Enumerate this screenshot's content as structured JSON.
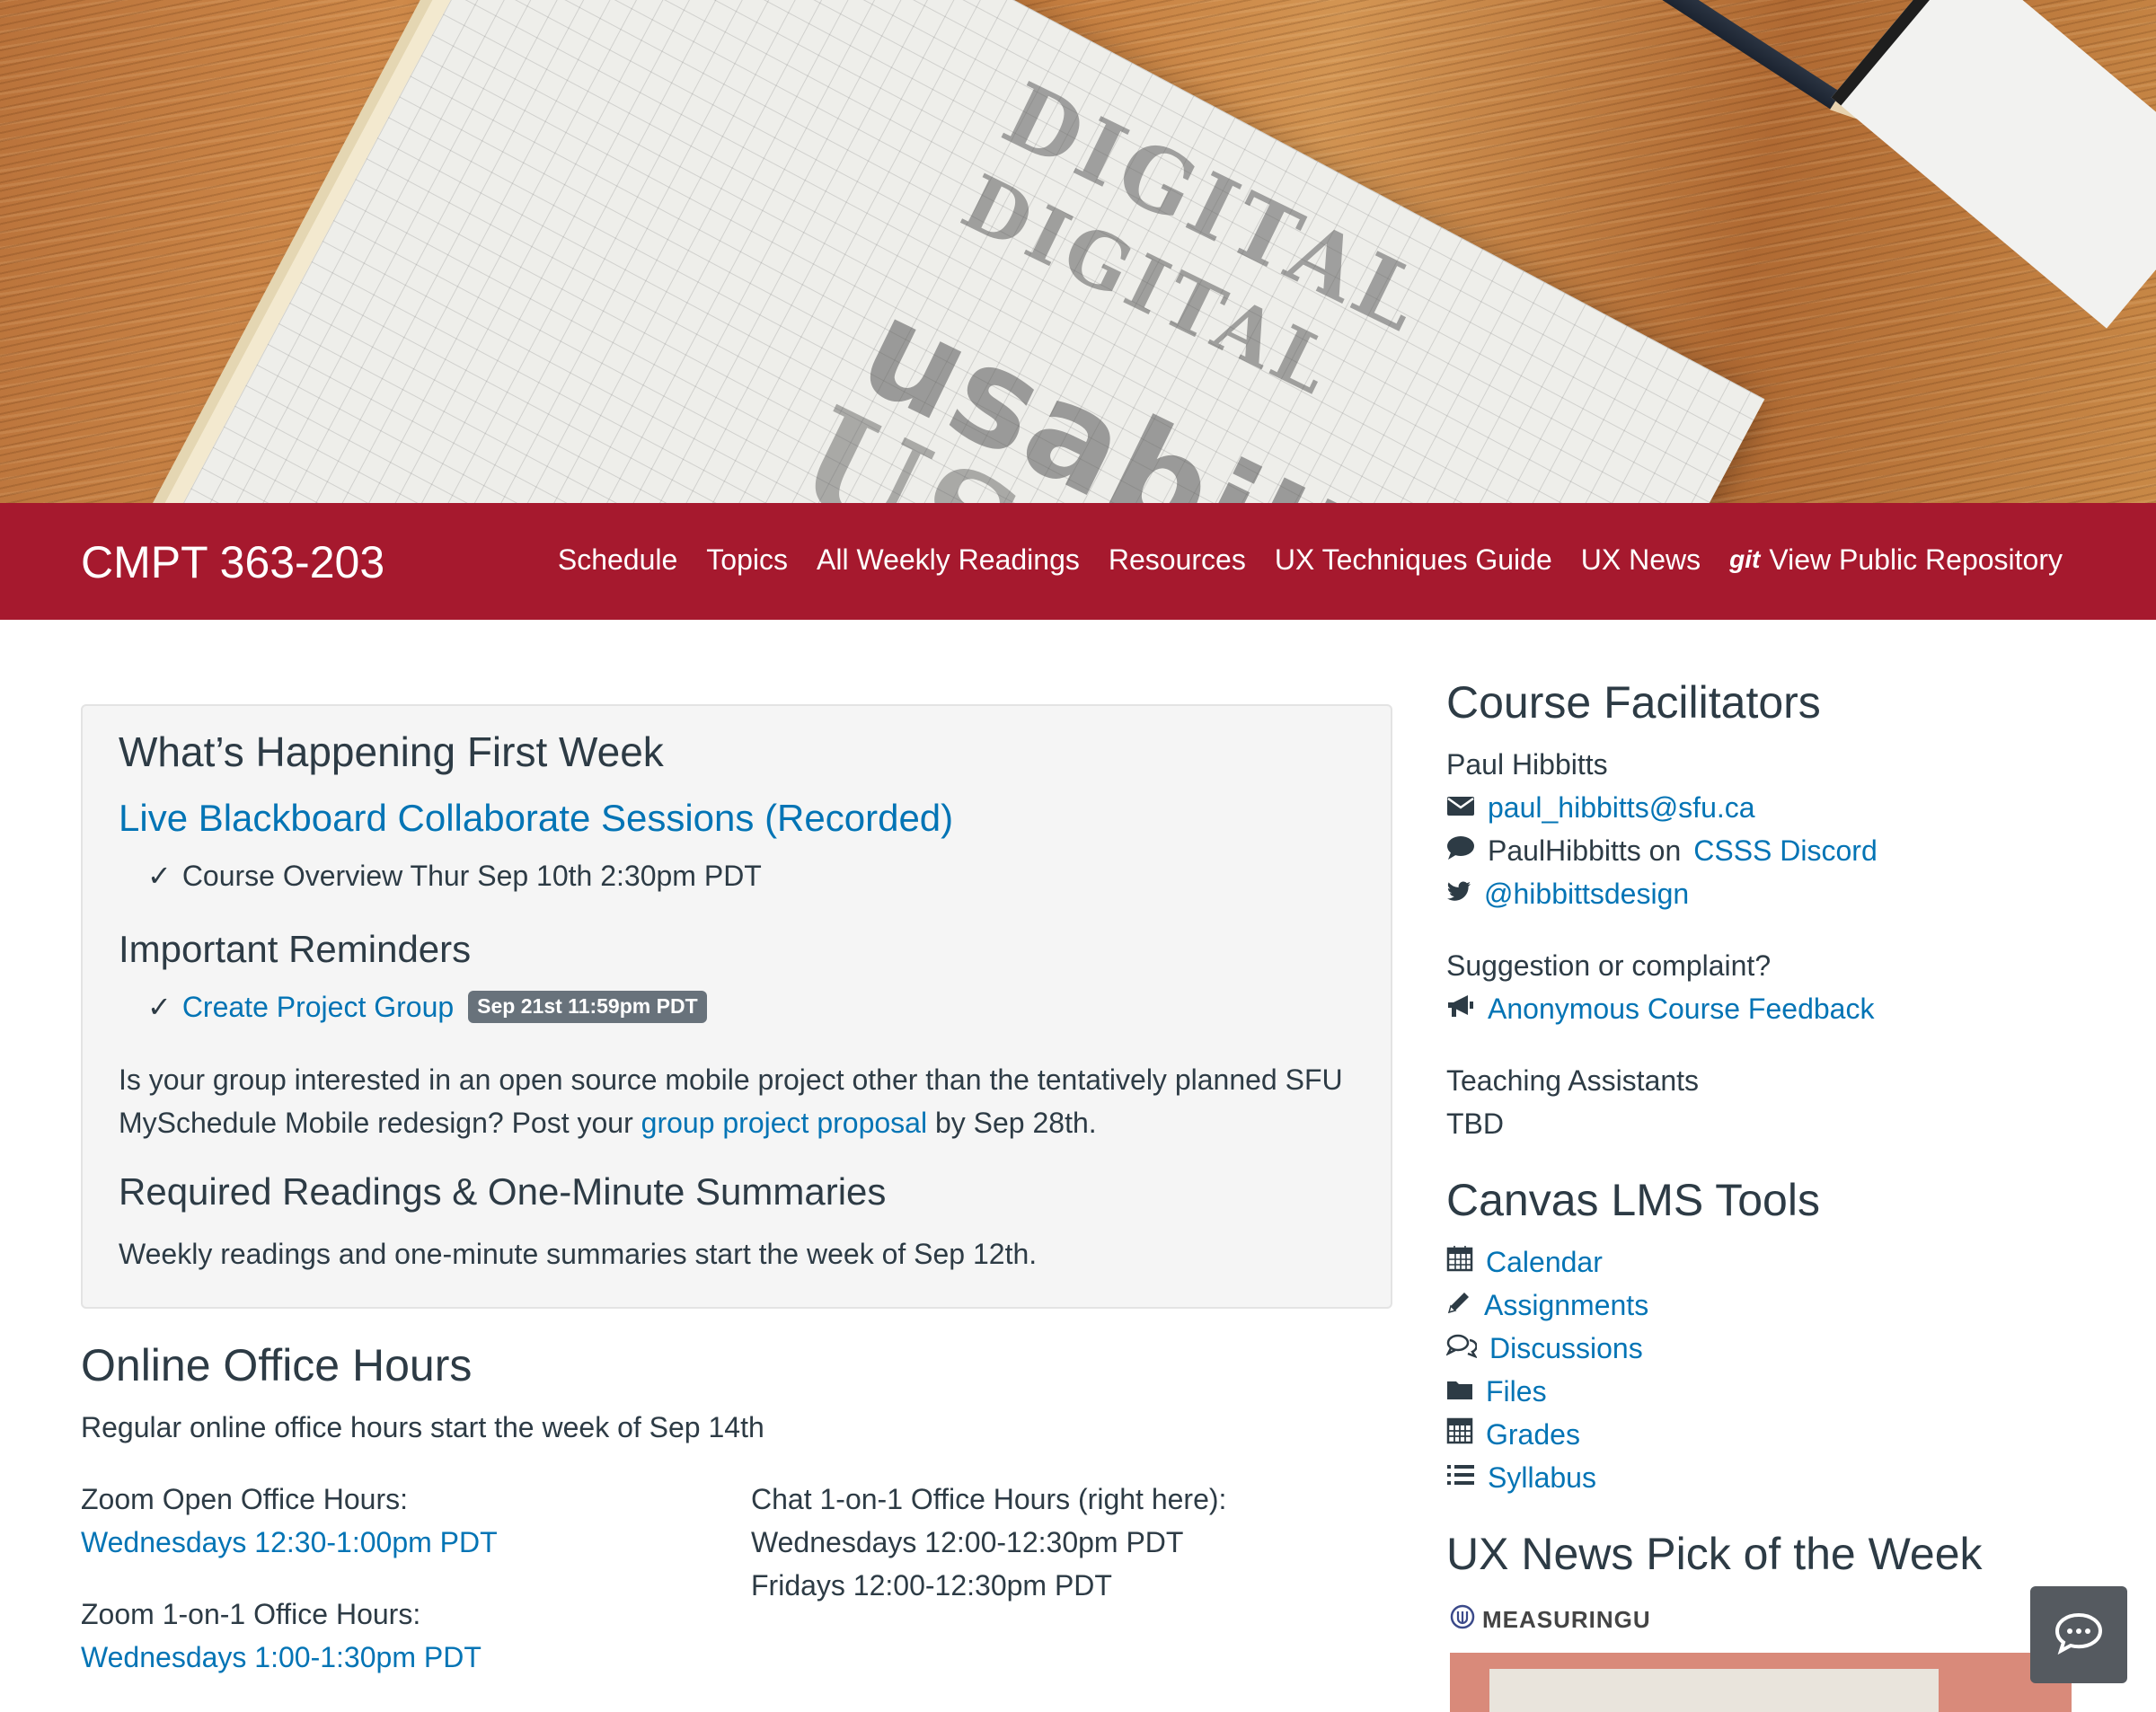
{
  "hero": {
    "sketch_lines": [
      "DIGITAL",
      "DIGITAL",
      "usabili",
      "USABI"
    ]
  },
  "navbar": {
    "brand": "CMPT 363-203",
    "items": [
      {
        "label": "Schedule"
      },
      {
        "label": "Topics"
      },
      {
        "label": "All Weekly Readings"
      },
      {
        "label": "Resources"
      },
      {
        "label": "UX Techniques Guide"
      },
      {
        "label": "UX News"
      },
      {
        "label": "View Public Repository",
        "icon": "git"
      }
    ],
    "background": "#a6192e"
  },
  "main": {
    "first_week": {
      "title": "What’s Happening First Week",
      "live_sessions": "Live Blackboard Collaborate Sessions (Recorded)",
      "session_item": "Course Overview Thur Sep 10th 2:30pm PDT",
      "reminders_title": "Important Reminders",
      "reminder_link": "Create Project Group",
      "reminder_badge": "Sep 21st 11:59pm PDT",
      "proposal_text_1": "Is your group interested in an open source mobile project other than the tentatively planned SFU",
      "proposal_text_2a": "MySchedule Mobile redesign? Post your",
      "proposal_link": "group project proposal",
      "proposal_text_2b": "by Sep 28th.",
      "readings_title": "Required Readings & One-Minute Summaries",
      "readings_text": "Weekly readings and one-minute summaries start the week of Sep 12th."
    },
    "office_hours": {
      "title": "Online Office Hours",
      "intro": "Regular online office hours start the week of Sep 14th",
      "zoom_open_label": "Zoom Open Office Hours:",
      "zoom_open_link": "Wednesdays 12:30-1:00pm PDT",
      "zoom_1on1_label": "Zoom 1-on-1 Office Hours:",
      "zoom_1on1_link": "Wednesdays 1:00-1:30pm PDT",
      "chat_label": "Chat 1-on-1 Office Hours (right here):",
      "chat_line_1": "Wednesdays 12:00-12:30pm PDT",
      "chat_line_2": "Fridays 12:00-12:30pm PDT"
    }
  },
  "sidebar": {
    "facilitators_title": "Course Facilitators",
    "facilitator_name": "Paul Hibbitts",
    "email": "paul_hibbitts@sfu.ca",
    "discord_prefix": "PaulHibbitts on",
    "discord_link": "CSSS Discord",
    "twitter": "@hibbittsdesign",
    "suggestion_label": "Suggestion or complaint?",
    "feedback_link": "Anonymous Course Feedback",
    "ta_label": "Teaching Assistants",
    "ta_value": "TBD",
    "canvas_title": "Canvas LMS Tools",
    "canvas_tools": [
      {
        "label": "Calendar",
        "icon": "calendar-icon"
      },
      {
        "label": "Assignments",
        "icon": "pencil-icon"
      },
      {
        "label": "Discussions",
        "icon": "comments-icon"
      },
      {
        "label": "Files",
        "icon": "folder-icon"
      },
      {
        "label": "Grades",
        "icon": "calculator-icon"
      },
      {
        "label": "Syllabus",
        "icon": "list-icon"
      }
    ],
    "news_title": "UX News Pick of the Week",
    "news_source": "MEASURINGU"
  },
  "colors": {
    "accent": "#a6192e",
    "link": "#0374b5",
    "text": "#2d3b45",
    "badge": "#68727b"
  }
}
